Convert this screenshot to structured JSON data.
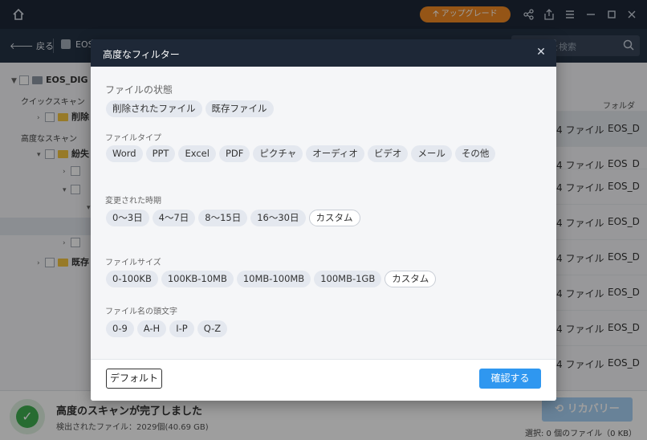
{
  "titlebar": {
    "upgrade_label": "アップグレード",
    "upgrade_arrow": "🡡",
    "icons": [
      "share-icon",
      "export-icon",
      "menu-icon",
      "minimize-icon",
      "maximize-icon",
      "close-icon"
    ]
  },
  "nav": {
    "back_label": "戻る",
    "back_arrow": "🡐",
    "drive_name": "EOS",
    "search_placeholder": "ォルダーを検索"
  },
  "sidebar": {
    "root_label": "EOS_DIG",
    "quick_scan_label": "クイックスキャン",
    "quick_item": "削除",
    "deep_scan_label": "高度なスキャン",
    "deep_item": "紛失",
    "existing_item": "既存"
  },
  "rightlist": {
    "header": "フォルダ",
    "rows": [
      {
        "count": "4 ファイル",
        "folder": "EOS_D"
      },
      {
        "count": "4 ファイル",
        "folder": "EOS_D"
      },
      {
        "count": "4 ファイル",
        "folder": "EOS_D"
      },
      {
        "count": "4 ファイル",
        "folder": "EOS_D"
      },
      {
        "count": "4 ファイル",
        "folder": "EOS_D"
      },
      {
        "count": "4 ファイル",
        "folder": "EOS_D"
      },
      {
        "count": "4 ファイル",
        "folder": "EOS_D"
      },
      {
        "count": "4 ファイル",
        "folder": "EOS_D"
      }
    ]
  },
  "bottom": {
    "title": "高度のスキャンが完了しました",
    "subtitle": "検出されたファイル：2029個(40.69 GB)",
    "recover_label": "リカバリー",
    "selection_info": "選択: 0 個のファイル（0 KB）"
  },
  "dialog": {
    "title": "高度なフィルター",
    "close_glyph": "✕",
    "groups": [
      {
        "label": "ファイルの状態",
        "chips": [
          {
            "text": "削除されたファイル",
            "outline": false
          },
          {
            "text": "既存ファイル",
            "outline": false
          }
        ]
      },
      {
        "label": "ファイルタイプ",
        "chips": [
          {
            "text": "Word",
            "outline": false
          },
          {
            "text": "PPT",
            "outline": false
          },
          {
            "text": "Excel",
            "outline": false
          },
          {
            "text": "PDF",
            "outline": false
          },
          {
            "text": "ピクチャ",
            "outline": false
          },
          {
            "text": "オーディオ",
            "outline": false
          },
          {
            "text": "ビデオ",
            "outline": false
          },
          {
            "text": "メール",
            "outline": false
          },
          {
            "text": "その他",
            "outline": false
          }
        ]
      },
      {
        "label": "変更された時期",
        "chips": [
          {
            "text": "0～3日",
            "outline": false
          },
          {
            "text": "4～7日",
            "outline": false
          },
          {
            "text": "8～15日",
            "outline": false
          },
          {
            "text": "16～30日",
            "outline": false
          },
          {
            "text": "カスタム",
            "outline": true
          }
        ]
      },
      {
        "label": "ファイルサイズ",
        "chips": [
          {
            "text": "0-100KB",
            "outline": false
          },
          {
            "text": "100KB-10MB",
            "outline": false
          },
          {
            "text": "10MB-100MB",
            "outline": false
          },
          {
            "text": "100MB-1GB",
            "outline": false
          },
          {
            "text": "カスタム",
            "outline": true
          }
        ]
      },
      {
        "label": "ファイル名の頭文字",
        "chips": [
          {
            "text": "0-9",
            "outline": false
          },
          {
            "text": "A-H",
            "outline": false
          },
          {
            "text": "I-P",
            "outline": false
          },
          {
            "text": "Q-Z",
            "outline": false
          }
        ]
      }
    ],
    "default_label": "デフォルト",
    "confirm_label": "確認する"
  },
  "colors": {
    "titlebar": "#1e2837",
    "accent": "#2f97f0",
    "upgrade": "#f08a24",
    "success": "#3fae4f"
  }
}
